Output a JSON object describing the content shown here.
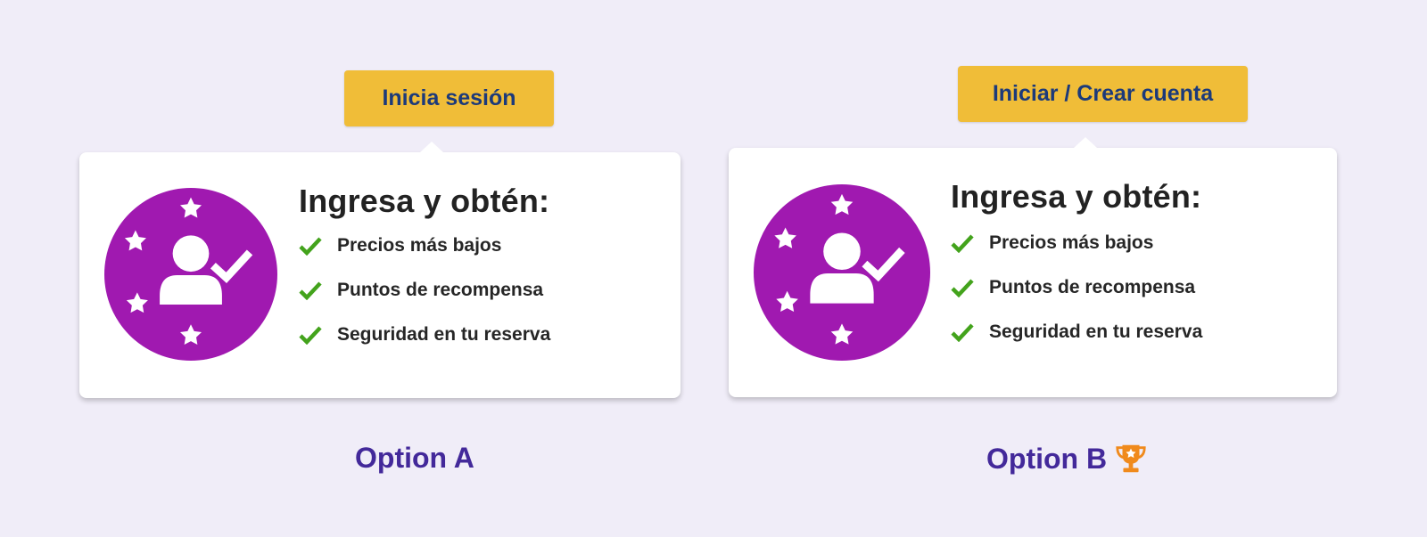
{
  "colors": {
    "background": "#f0edf8",
    "button": "#f0bd38",
    "button_text": "#1c3a7a",
    "badge": "#a019b0",
    "check": "#43a31c",
    "caption": "#43299a",
    "trophy": "#f08a1c"
  },
  "option_a": {
    "button_label": "Inicia sesión",
    "heading": "Ingresa y obtén:",
    "benefits": [
      "Precios más bajos",
      "Puntos de recompensa",
      "Seguridad en tu reserva"
    ],
    "caption": "Option A"
  },
  "option_b": {
    "button_label": "Iniciar / Crear cuenta",
    "heading": "Ingresa y obtén:",
    "benefits": [
      "Precios más bajos",
      "Puntos de recompensa",
      "Seguridad en tu reserva"
    ],
    "caption": "Option B",
    "winner_icon": "trophy-icon"
  }
}
